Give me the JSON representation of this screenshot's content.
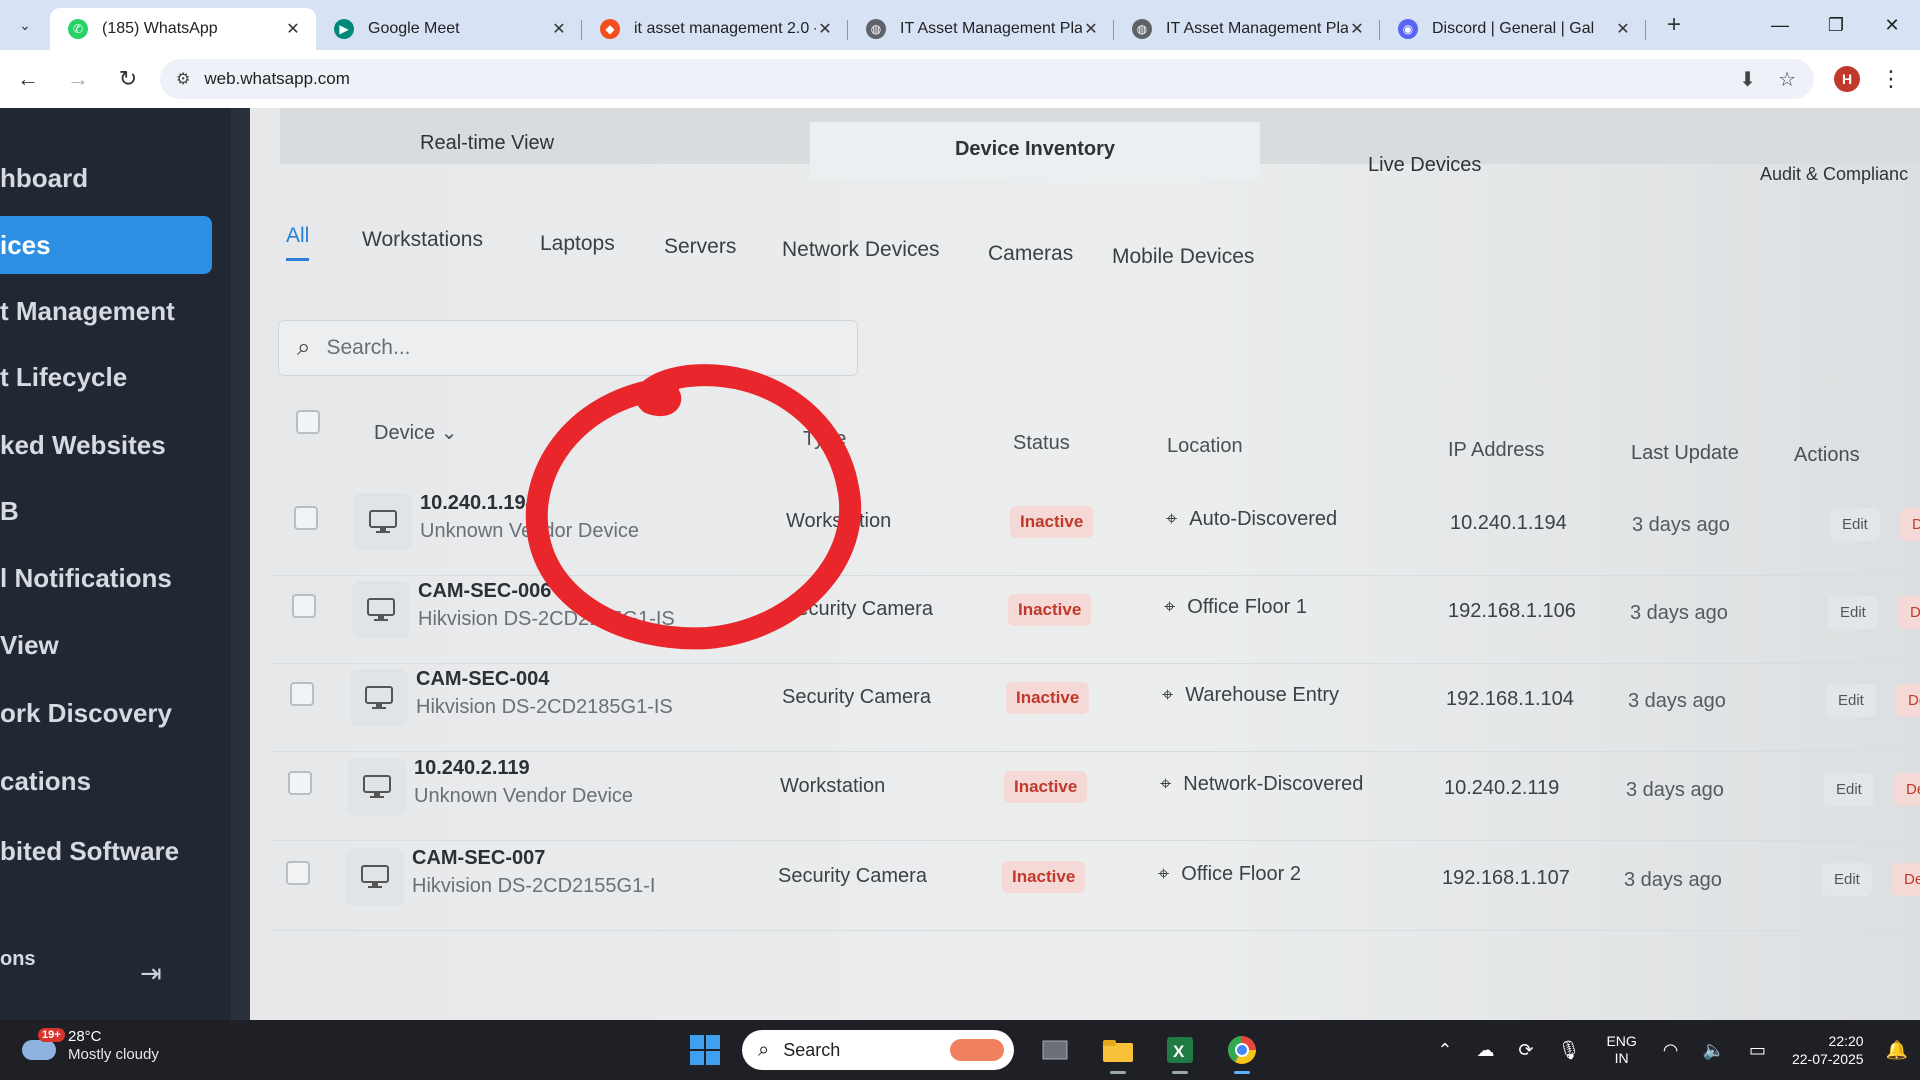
{
  "browser": {
    "tabs": [
      {
        "title": "(185) WhatsApp",
        "favicon": "whatsapp-icon",
        "color": "#25d366",
        "active": true
      },
      {
        "title": "Google Meet",
        "favicon": "google-meet-icon",
        "color": "#00897b",
        "active": false
      },
      {
        "title": "it asset management 2.0 -",
        "favicon": "figma-icon",
        "color": "#f24e1e",
        "active": false
      },
      {
        "title": "IT Asset Management Platf",
        "favicon": "globe-icon",
        "color": "#5f6368",
        "active": false
      },
      {
        "title": "IT Asset Management Platf",
        "favicon": "globe-icon",
        "color": "#5f6368",
        "active": false
      },
      {
        "title": "Discord | General | Gal",
        "favicon": "discord-icon",
        "color": "#5865f2",
        "active": false
      }
    ],
    "url": "web.whatsapp.com",
    "profile_initial": "H"
  },
  "app": {
    "sidebar": {
      "items": [
        {
          "label": "hboard",
          "active": false
        },
        {
          "label": "ices",
          "active": true
        },
        {
          "label": "t Management",
          "active": false
        },
        {
          "label": "t Lifecycle",
          "active": false
        },
        {
          "label": "ked Websites",
          "active": false
        },
        {
          "label": "B",
          "active": false
        },
        {
          "label": "l Notifications",
          "active": false
        },
        {
          "label": "View",
          "active": false
        },
        {
          "label": "ork Discovery",
          "active": false
        },
        {
          "label": "cations",
          "active": false
        },
        {
          "label": "bited Software",
          "active": false
        },
        {
          "label": "ons",
          "active": false
        }
      ]
    },
    "view_tabs": [
      "Real-time View",
      "Device Inventory",
      "Live Devices",
      "Audit & Complianc"
    ],
    "active_view_tab": "Device Inventory",
    "category_tabs": [
      "All",
      "Workstations",
      "Laptops",
      "Servers",
      "Network Devices",
      "Cameras",
      "Mobile Devices"
    ],
    "active_category": "All",
    "search": {
      "placeholder": "Search...",
      "value": ""
    },
    "table": {
      "headers": {
        "device": "Device",
        "type": "Type",
        "status": "Status",
        "location": "Location",
        "ip": "IP Address",
        "updated": "Last Update",
        "actions": "Actions"
      },
      "rows": [
        {
          "name": "10.240.1.194",
          "vendor": "Unknown Vendor Device",
          "type": "Workstation",
          "status": "Inactive",
          "location": "Auto-Discovered",
          "ip": "10.240.1.194",
          "updated": "3 days ago",
          "edit": "Edit",
          "delete": "De"
        },
        {
          "name": "CAM-SEC-006",
          "vendor": "Hikvision DS-2CD2185G1-IS",
          "type": "Security Camera",
          "status": "Inactive",
          "location": "Office Floor 1",
          "ip": "192.168.1.106",
          "updated": "3 days ago",
          "edit": "Edit",
          "delete": "De"
        },
        {
          "name": "CAM-SEC-004",
          "vendor": "Hikvision DS-2CD2185G1-IS",
          "type": "Security Camera",
          "status": "Inactive",
          "location": "Warehouse Entry",
          "ip": "192.168.1.104",
          "updated": "3 days ago",
          "edit": "Edit",
          "delete": "De"
        },
        {
          "name": "10.240.2.119",
          "vendor": "Unknown Vendor Device",
          "type": "Workstation",
          "status": "Inactive",
          "location": "Network-Discovered",
          "ip": "10.240.2.119",
          "updated": "3 days ago",
          "edit": "Edit",
          "delete": "De"
        },
        {
          "name": "CAM-SEC-007",
          "vendor": "Hikvision DS-2CD2155G1-I",
          "type": "Security Camera",
          "status": "Inactive",
          "location": "Office Floor 2",
          "ip": "192.168.1.107",
          "updated": "3 days ago",
          "edit": "Edit",
          "delete": "De"
        }
      ]
    },
    "annotation_color": "#e8262b"
  },
  "taskbar": {
    "weather": {
      "temp": "28°C",
      "condition": "Mostly cloudy",
      "alert_count": "19+"
    },
    "search_label": "Search",
    "language": {
      "line1": "ENG",
      "line2": "IN"
    },
    "time": "22:20",
    "date": "22-07-2025"
  }
}
